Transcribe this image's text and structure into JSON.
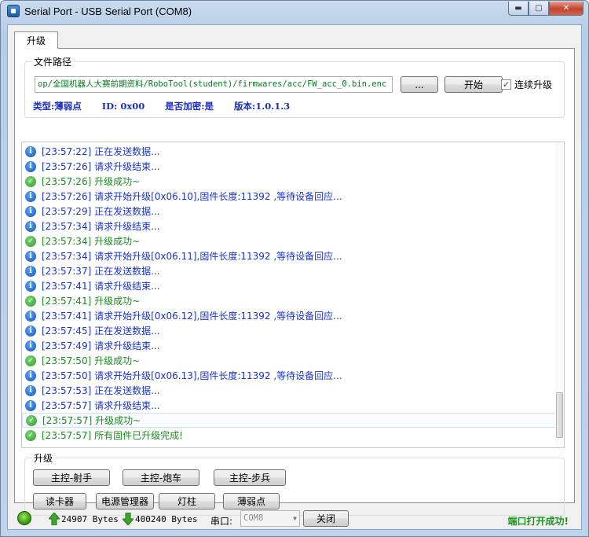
{
  "window": {
    "title": "Serial Port - USB Serial Port (COM8)",
    "controls": {
      "minimize": "▬",
      "maximize": "▢",
      "close": "✕"
    }
  },
  "tabs": [
    {
      "label": "升级",
      "active": true
    }
  ],
  "file_group": {
    "title": "文件路径",
    "path_value": "op/全国机器人大赛前期资料/RoboTool(student)/firmwares/acc/FW_acc_0.bin.enc",
    "browse_label": "...",
    "start_label": "开始",
    "continuous_label": "连续升级",
    "continuous_checked": true,
    "info": {
      "type": "类型:薄弱点",
      "id": "ID: 0x00",
      "encrypted": "是否加密:是",
      "version": "版本:1.0.1.3"
    }
  },
  "log": [
    {
      "kind": "info",
      "text": "[23:57:22] 正在发送数据..."
    },
    {
      "kind": "info",
      "text": "[23:57:26] 请求升级结束..."
    },
    {
      "kind": "success",
      "text": "[23:57:26] 升级成功~"
    },
    {
      "kind": "info",
      "text": "[23:57:26] 请求开始升级[0x06.10],固件长度:11392 ,等待设备回应..."
    },
    {
      "kind": "info",
      "text": "[23:57:29] 正在发送数据..."
    },
    {
      "kind": "info",
      "text": "[23:57:34] 请求升级结束..."
    },
    {
      "kind": "success",
      "text": "[23:57:34] 升级成功~"
    },
    {
      "kind": "info",
      "text": "[23:57:34] 请求开始升级[0x06.11],固件长度:11392 ,等待设备回应..."
    },
    {
      "kind": "info",
      "text": "[23:57:37] 正在发送数据..."
    },
    {
      "kind": "info",
      "text": "[23:57:41] 请求升级结束..."
    },
    {
      "kind": "success",
      "text": "[23:57:41] 升级成功~"
    },
    {
      "kind": "info",
      "text": "[23:57:41] 请求开始升级[0x06.12],固件长度:11392 ,等待设备回应..."
    },
    {
      "kind": "info",
      "text": "[23:57:45] 正在发送数据..."
    },
    {
      "kind": "info",
      "text": "[23:57:49] 请求升级结束..."
    },
    {
      "kind": "success",
      "text": "[23:57:50] 升级成功~"
    },
    {
      "kind": "info",
      "text": "[23:57:50] 请求开始升级[0x06.13],固件长度:11392 ,等待设备回应..."
    },
    {
      "kind": "info",
      "text": "[23:57:53] 正在发送数据..."
    },
    {
      "kind": "info",
      "text": "[23:57:57] 请求升级结束..."
    },
    {
      "kind": "success",
      "text": "[23:57:57] 升级成功~",
      "selected": true
    },
    {
      "kind": "success",
      "text": "[23:57:57] 所有固件已升级完成!"
    }
  ],
  "upgrade_group": {
    "title": "升级",
    "row1": [
      "主控-射手",
      "主控-炮车",
      "主控-步兵"
    ],
    "row2": [
      "读卡器",
      "电源管理器",
      "灯柱",
      "薄弱点"
    ]
  },
  "status": {
    "tx_bytes": "24907 Bytes",
    "rx_bytes": "400240 Bytes",
    "port_label": "串口:",
    "port_value": "COM8",
    "close_label": "关闭",
    "message": "端口打开成功!",
    "colors": {
      "led": "#5ccc2a",
      "tx_arrow": "#3aa52a",
      "rx_arrow": "#3aa52a",
      "message": "#18961b"
    }
  }
}
